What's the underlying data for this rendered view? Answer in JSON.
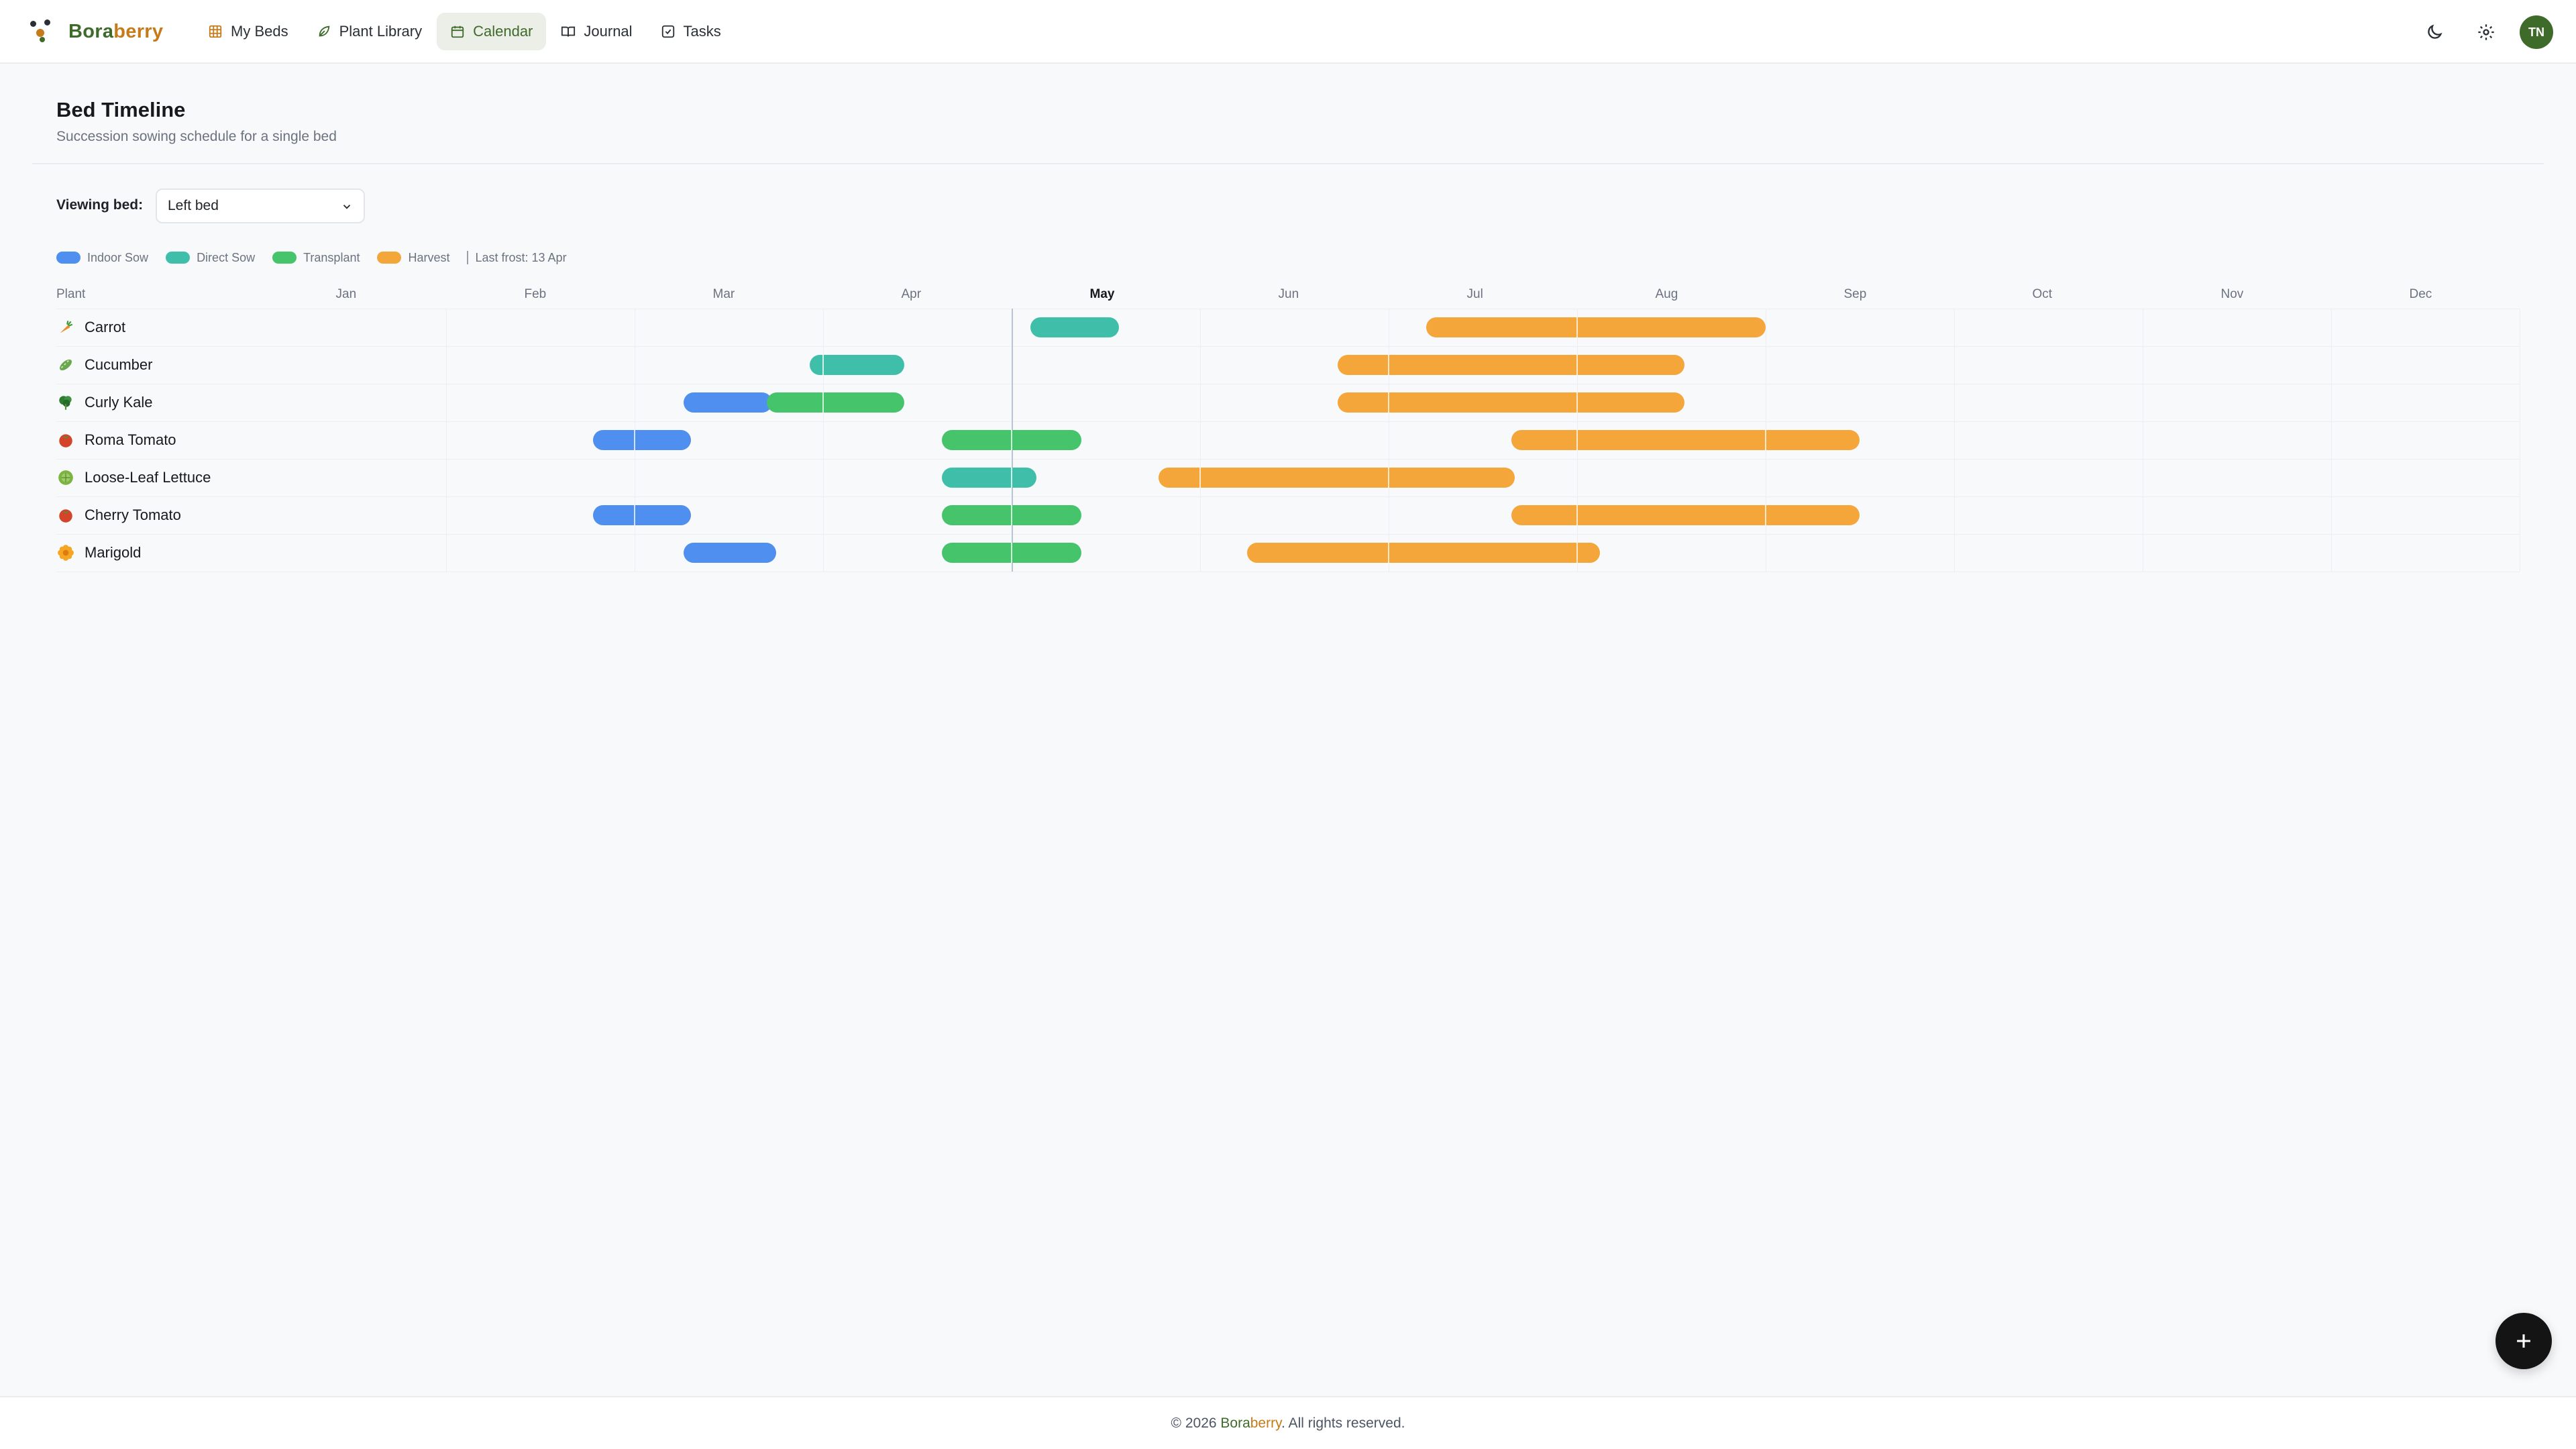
{
  "app": {
    "brand_part1": "Bora",
    "brand_part2": "berry"
  },
  "nav": {
    "items": [
      {
        "id": "beds",
        "label": "My Beds",
        "icon": "grid-icon"
      },
      {
        "id": "library",
        "label": "Plant Library",
        "icon": "leaf-icon"
      },
      {
        "id": "calendar",
        "label": "Calendar",
        "icon": "calendar-icon",
        "active": true
      },
      {
        "id": "journal",
        "label": "Journal",
        "icon": "book-icon"
      },
      {
        "id": "tasks",
        "label": "Tasks",
        "icon": "checkbox-icon"
      }
    ]
  },
  "user": {
    "initials": "TN"
  },
  "page": {
    "title": "Bed Timeline",
    "subtitle": "Succession sowing schedule for a single bed"
  },
  "filter": {
    "label": "Viewing bed:",
    "selected": "Left bed"
  },
  "legend": {
    "items": [
      {
        "key": "indoor",
        "label": "Indoor Sow",
        "color": "#4e8ff0"
      },
      {
        "key": "direct",
        "label": "Direct Sow",
        "color": "#3fbfaa"
      },
      {
        "key": "transplant",
        "label": "Transplant",
        "color": "#46c46c"
      },
      {
        "key": "harvest",
        "label": "Harvest",
        "color": "#f4a63a"
      }
    ],
    "frost": "Last frost: 13 Apr"
  },
  "timeline": {
    "plant_header": "Plant",
    "months": [
      "Jan",
      "Feb",
      "Mar",
      "Apr",
      "May",
      "Jun",
      "Jul",
      "Aug",
      "Sep",
      "Oct",
      "Nov",
      "Dec"
    ],
    "current_month": "May",
    "today_month_position": 4.0,
    "plants": [
      {
        "name": "Carrot",
        "icon": "carrot-icon",
        "icon_color": "#f08a24",
        "bars": [
          {
            "type": "direct",
            "start": 4.1,
            "end": 4.57
          },
          {
            "type": "harvest",
            "start": 6.2,
            "end": 8.0
          }
        ]
      },
      {
        "name": "Cucumber",
        "icon": "cucumber-icon",
        "icon_color": "#6aa84f",
        "bars": [
          {
            "type": "direct",
            "start": 2.93,
            "end": 3.43
          },
          {
            "type": "harvest",
            "start": 5.73,
            "end": 7.57
          }
        ]
      },
      {
        "name": "Curly Kale",
        "icon": "kale-icon",
        "icon_color": "#2f7d32",
        "bars": [
          {
            "type": "indoor",
            "start": 2.26,
            "end": 2.73
          },
          {
            "type": "transplant",
            "start": 2.7,
            "end": 3.43
          },
          {
            "type": "harvest",
            "start": 5.73,
            "end": 7.57
          }
        ]
      },
      {
        "name": "Roma Tomato",
        "icon": "tomato-icon",
        "icon_color": "#d2452b",
        "bars": [
          {
            "type": "indoor",
            "start": 1.78,
            "end": 2.3
          },
          {
            "type": "transplant",
            "start": 3.63,
            "end": 4.37
          },
          {
            "type": "harvest",
            "start": 6.65,
            "end": 8.5
          }
        ]
      },
      {
        "name": "Loose-Leaf Lettuce",
        "icon": "lettuce-icon",
        "icon_color": "#7cb342",
        "bars": [
          {
            "type": "direct",
            "start": 3.63,
            "end": 4.13
          },
          {
            "type": "harvest",
            "start": 4.78,
            "end": 6.67
          }
        ]
      },
      {
        "name": "Cherry Tomato",
        "icon": "tomato-icon",
        "icon_color": "#d2452b",
        "bars": [
          {
            "type": "indoor",
            "start": 1.78,
            "end": 2.3
          },
          {
            "type": "transplant",
            "start": 3.63,
            "end": 4.37
          },
          {
            "type": "harvest",
            "start": 6.65,
            "end": 8.5
          }
        ]
      },
      {
        "name": "Marigold",
        "icon": "marigold-icon",
        "icon_color": "#f5a623",
        "bars": [
          {
            "type": "indoor",
            "start": 2.26,
            "end": 2.75
          },
          {
            "type": "transplant",
            "start": 3.63,
            "end": 4.37
          },
          {
            "type": "harvest",
            "start": 5.25,
            "end": 7.12
          }
        ]
      }
    ]
  },
  "footer": {
    "prefix": "© 2026 ",
    "brand_part1": "Bora",
    "brand_part2": "berry",
    "suffix": ". All rights reserved."
  }
}
